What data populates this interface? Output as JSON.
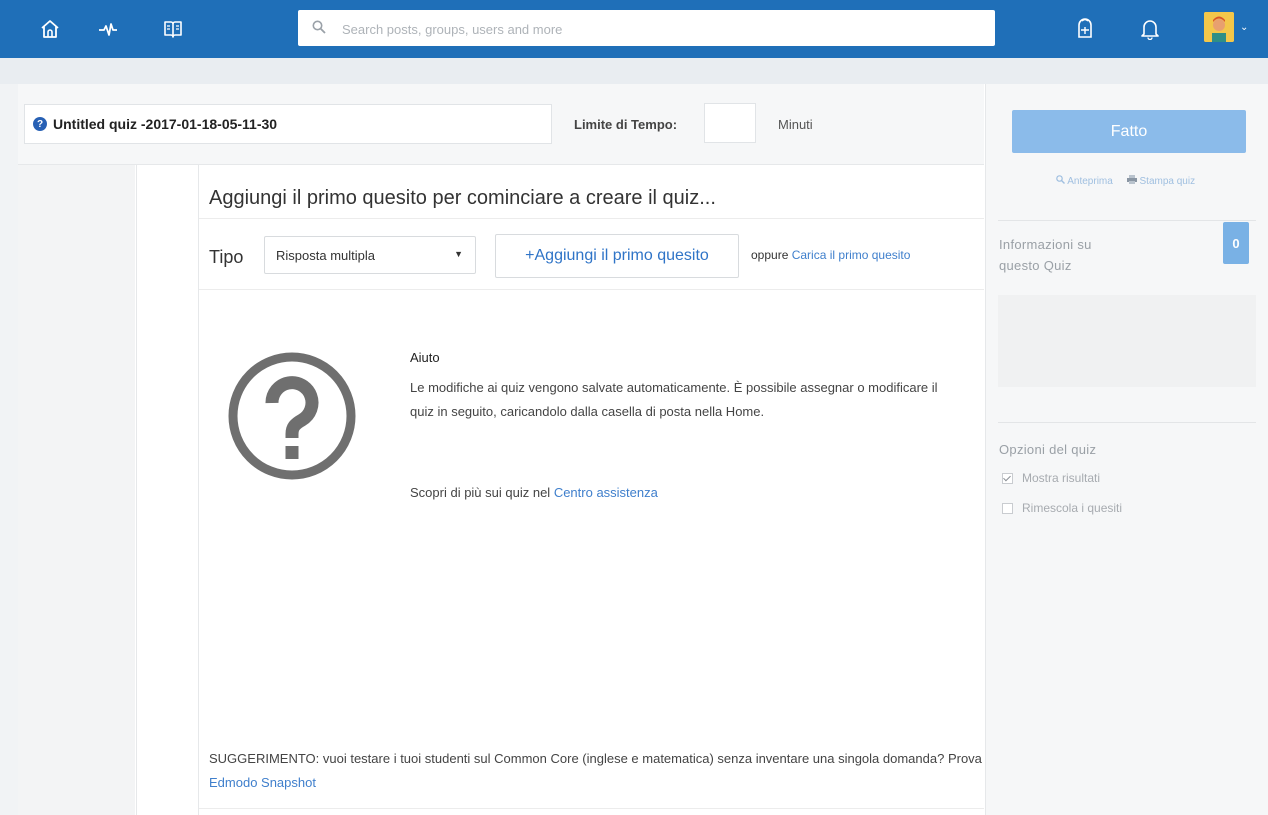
{
  "topbar": {
    "search_placeholder": "Search posts, groups, users and more",
    "colors": {
      "bar": "#1f6fb8"
    }
  },
  "quiz": {
    "title": "Untitled quiz -2017-01-18-05-11-30",
    "time_label": "Limite di Tempo:",
    "time_value": "",
    "time_unit": "Minuti"
  },
  "main": {
    "heading": "Aggiungi il primo quesito per cominciare a creare il quiz...",
    "tipo_label": "Tipo",
    "question_type": "Risposta multipla",
    "add_button": "+Aggiungi il primo quesito",
    "or_text": "oppure",
    "upload_link": "Carica il primo quesito"
  },
  "help": {
    "title": "Aiuto",
    "body": "Le modifiche ai quiz vengono salvate automaticamente. È possibile assegnar o modificare il quiz in seguito, caricandolo dalla casella di posta nella Home.",
    "more_prefix": "Scopri di più sui quiz nel ",
    "more_link": "Centro assistenza"
  },
  "tip": {
    "text": "SUGGERIMENTO: vuoi testare i tuoi studenti sul Common Core (inglese e matematica) senza inventare una singola domanda? Prova ",
    "link": "Edmodo Snapshot"
  },
  "sidebar": {
    "done_button": "Fatto",
    "preview": "Anteprima",
    "print": "Stampa quiz",
    "info_title": "Informazioni su questo Quiz",
    "info_count": "0",
    "options_title": "Opzioni del quiz",
    "options": [
      {
        "label": "Mostra risultati",
        "checked": true
      },
      {
        "label": "Rimescola i quesiti",
        "checked": false
      }
    ]
  }
}
